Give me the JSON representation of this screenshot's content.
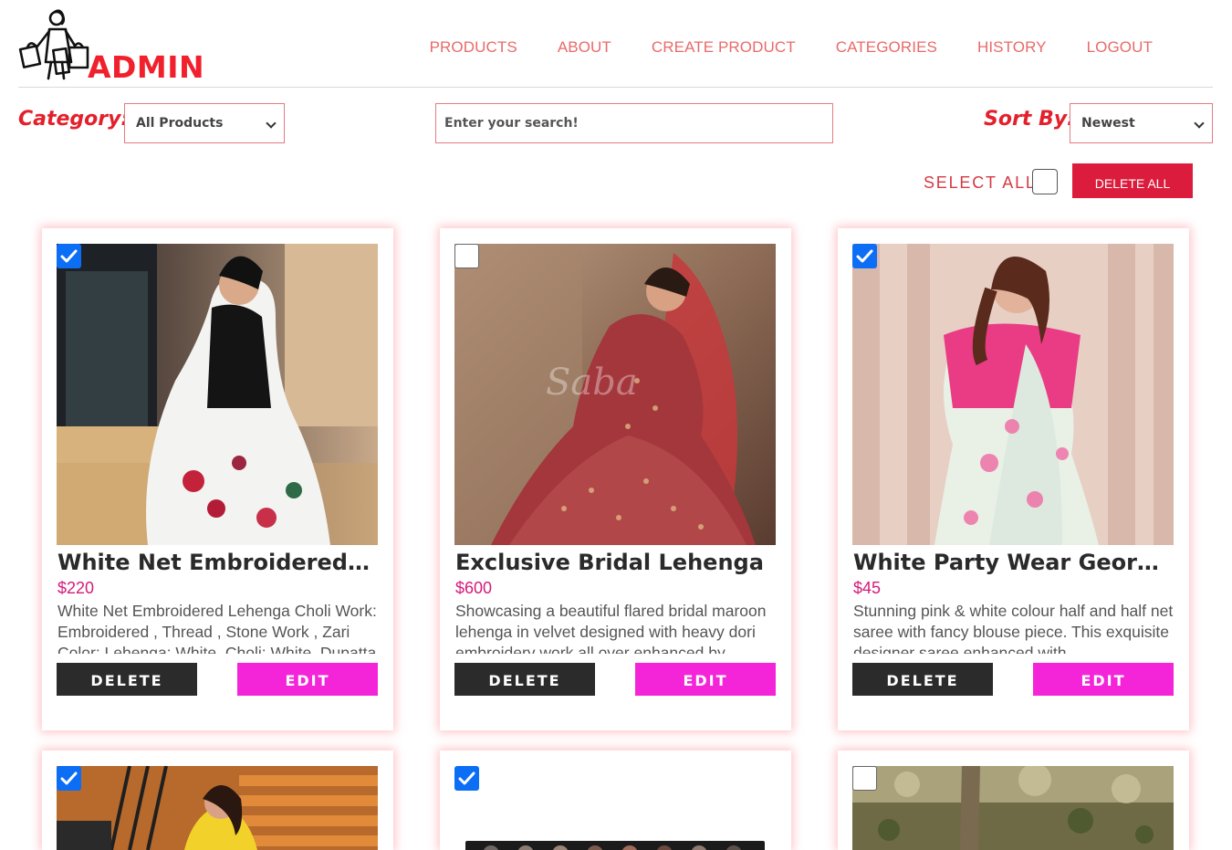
{
  "header": {
    "logo_text": "ADMIN",
    "nav": [
      "PRODUCTS",
      "ABOUT",
      "CREATE PRODUCT",
      "CATEGORIES",
      "HISTORY",
      "LOGOUT"
    ]
  },
  "filters": {
    "category_label": "Category:",
    "category_value": "All Products",
    "search_placeholder": "Enter your search!",
    "sort_label": "Sort By:",
    "sort_value": "Newest"
  },
  "bulk": {
    "select_all_label": "SELECT ALL",
    "delete_all_label": "DELETE ALL",
    "select_all_checked": false
  },
  "card_actions": {
    "delete_label": "DELETE",
    "edit_label": "EDIT"
  },
  "products": [
    {
      "title": "White Net Embroidered Lehenga Choli",
      "price": "$220",
      "description": "White Net Embroidered Lehenga Choli Work: Embroidered , Thread , Stone Work , Zari Color: Lehenga: White, Choli: White, Dupatta",
      "checked": true
    },
    {
      "title": "Exclusive Bridal Lehenga",
      "price": "$600",
      "description": "Showcasing a beautiful flared bridal maroon lehenga in velvet designed with heavy dori embroidery work all over enhanced by",
      "checked": false
    },
    {
      "title": "White Party Wear Georgette Saree",
      "price": "$45",
      "description": "Stunning pink & white colour half and half net saree with fancy blouse piece. This exquisite designer saree enhanced with",
      "checked": true
    },
    {
      "title": "",
      "price": "",
      "description": "",
      "checked": true
    },
    {
      "title": "",
      "price": "",
      "description": "",
      "checked": true
    },
    {
      "title": "",
      "price": "",
      "description": "",
      "checked": false
    }
  ],
  "colors": {
    "brand_red": "#f0212d",
    "nav_text": "#e96a6a",
    "delete_all_bg": "#dc1c3c",
    "edit_bg": "#f425d9",
    "delete_bg": "#2b2b2b",
    "price": "#d41b7b",
    "checkbox": "#0b6ef5"
  }
}
